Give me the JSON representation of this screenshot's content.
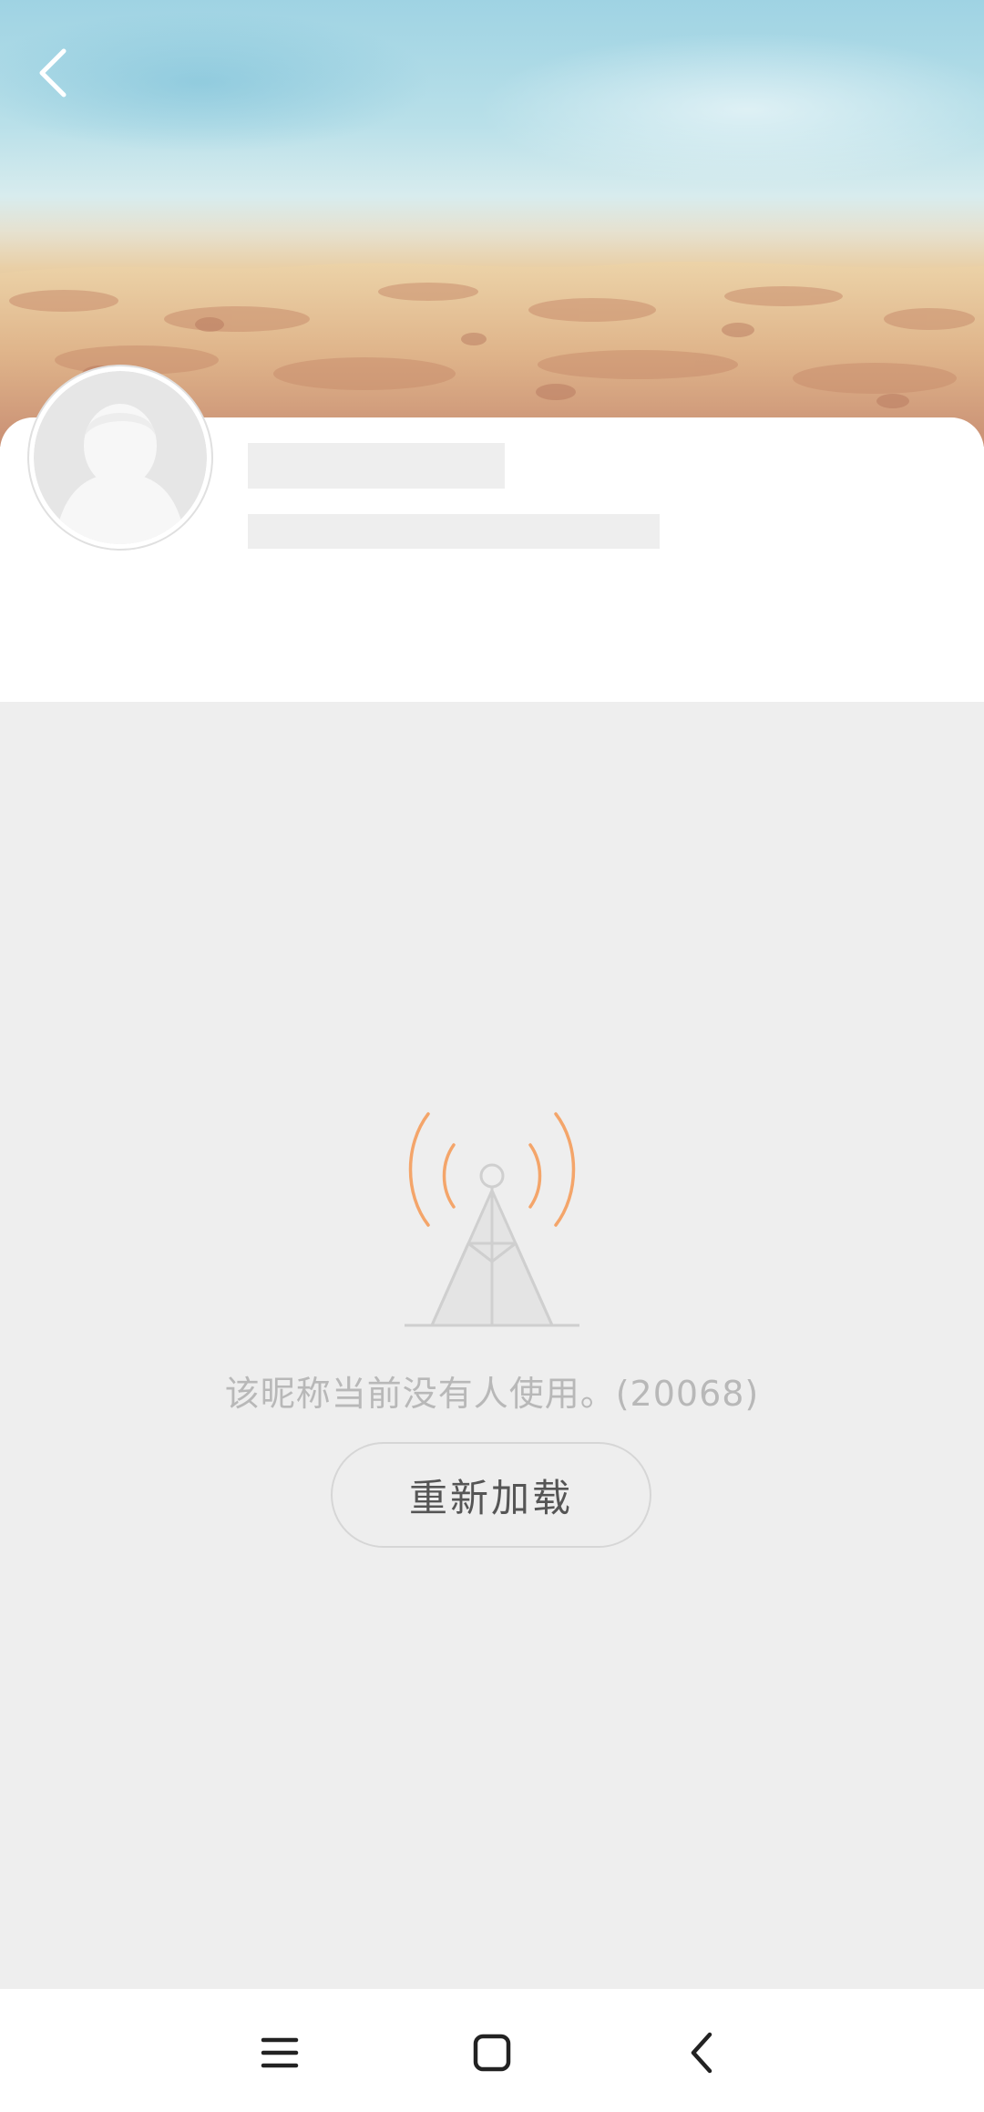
{
  "header": {
    "back_icon": "chevron-left-icon",
    "banner_image": "beach-sand-banner"
  },
  "profile": {
    "avatar_icon": "default-avatar-icon",
    "name": "",
    "subtitle": ""
  },
  "error_state": {
    "icon": "signal-tower-icon",
    "message": "该昵称当前没有人使用。(20068)",
    "reload_label": "重新加载",
    "accent_color": "#f4a56a"
  },
  "nav_bar": {
    "menu_icon": "menu-icon",
    "home_icon": "home-square-icon",
    "back_icon": "back-chevron-icon"
  }
}
